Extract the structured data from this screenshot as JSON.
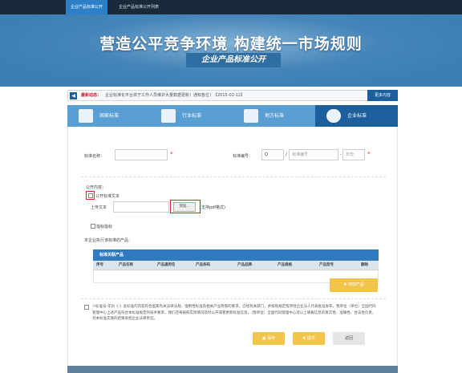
{
  "topnav": {
    "tabs": [
      {
        "label": "企业产品标准公开"
      },
      {
        "label": "企业产品标准公开列表"
      }
    ]
  },
  "banner": {
    "title": "营造公平竞争环境 构建统一市场规则",
    "subtitle": "企业产品标准公开"
  },
  "notice": {
    "label": "最新动态：",
    "text": "企业标准化平台将于工作人员维护大量数据更新！通知各位！【2015-02-12】",
    "more": "更多内容"
  },
  "categories": [
    {
      "label": "国家标准",
      "icon": "document-icon"
    },
    {
      "label": "行业标准",
      "icon": "briefcase-icon"
    },
    {
      "label": "地方标准",
      "icon": "clipboard-icon"
    },
    {
      "label": "企业标准",
      "icon": "search-cloud-icon"
    }
  ],
  "form": {
    "name_label": "标准名称：",
    "name_value": "",
    "number_label": "标准编号：",
    "number_prefix": "Q",
    "number_placeholder": "标准编号",
    "year_placeholder": "年份",
    "public_label": "公开内容：",
    "public_checkbox_label": "公开标准文本",
    "upload_label": "上传文本",
    "browse_label": "浏览...",
    "format_hint": "(支持pdf格式)",
    "index_checkbox_label": "指标指标",
    "products_heading": "本企业执行该标准的产品：",
    "table_caption": "标准关联产品",
    "columns": [
      "序号",
      "产品名称",
      "产品通用名",
      "产品条码",
      "产品品牌",
      "产品规格",
      "产品型号",
      "删除"
    ],
    "add_product": "增加产品",
    "declaration": "①标准号-年份《 》此标准的内容符合国家有关法律法规、强制性标准及相关产业政策的要求，已经有关部门，并按照规定程序经企业法人代表批准发布。我单位（单位）全国代码管理中心上述产品符合本标准规定的技术要求，我们还将按照实际情况及时公开或者更新标准信息。（我单位）全国代码管理中心对以上填报信息的真实性、准确性、合法性负责，对本标准实施的结果承担企业法律责任。",
    "save": "保存",
    "submit": "提交",
    "back": "返回"
  },
  "colors": {
    "primary": "#1d5f9c",
    "category_bar": "#5a9fd4",
    "accent_yellow": "#f2c44a",
    "required": "#d22222",
    "highlight": "#e02020"
  }
}
